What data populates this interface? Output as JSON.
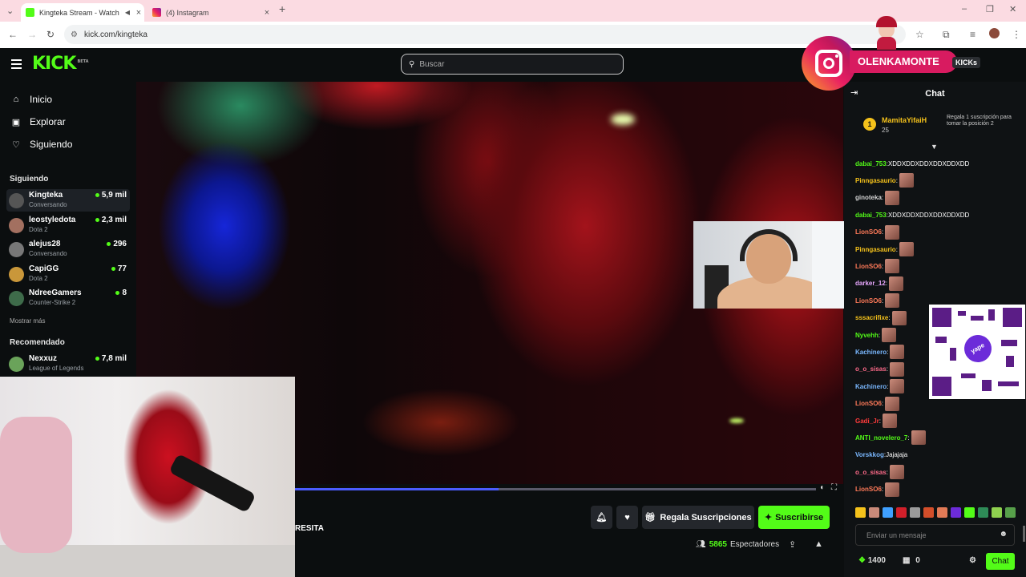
{
  "browser": {
    "tabs": [
      {
        "title": "Kingteka Stream - Watch Li",
        "active": true
      },
      {
        "title": "(4) Instagram",
        "active": false
      }
    ],
    "url": "kick.com/kingteka"
  },
  "header": {
    "logo": "KICK",
    "logo_badge": "BETA",
    "search_placeholder": "Buscar"
  },
  "sidebar": {
    "nav": [
      {
        "label": "Inicio",
        "icon": "home-icon"
      },
      {
        "label": "Explorar",
        "icon": "compass-icon"
      },
      {
        "label": "Siguiendo",
        "icon": "heart-icon"
      }
    ],
    "following_title": "Siguiendo",
    "following": [
      {
        "name": "Kingteka",
        "category": "Conversando",
        "viewers": "5,9 mil"
      },
      {
        "name": "leostyledota",
        "category": "Dota 2",
        "viewers": "2,3 mil"
      },
      {
        "name": "alejus28",
        "category": "Conversando",
        "viewers": "296"
      },
      {
        "name": "CapiGG",
        "category": "Dota 2",
        "viewers": "77"
      },
      {
        "name": "NdreeGamers",
        "category": "Counter-Strike 2",
        "viewers": "8"
      }
    ],
    "show_more": "Mostrar más",
    "recommended_title": "Recomendado",
    "recommended": [
      {
        "name": "Nexxuz",
        "category": "League of Legends",
        "viewers": "7,8 mil"
      }
    ]
  },
  "player": {
    "progress": 0.39
  },
  "stream_info": {
    "streamer_fragment": "RESITA",
    "gift_subs_label": "Regala Suscripciones",
    "subscribe_label": "Suscribirse",
    "viewers_count": "5865",
    "viewers_label": "Espectadores"
  },
  "chat": {
    "title": "Chat",
    "pinned": {
      "rank": "1",
      "user": "MamitaYifaiH",
      "count": "25",
      "text": "Regala 1 suscripción para tomar la posición 2"
    },
    "messages": [
      {
        "user": "dabai_753",
        "text": "XDDXDDXDDXDDXDDXDD",
        "color": "#53fc18",
        "emote": false
      },
      {
        "user": "Pinngasaurio",
        "text": "",
        "color": "#f5c21b",
        "emote": true
      },
      {
        "user": "ginoteka",
        "text": "",
        "color": "#d4d4d4",
        "emote": true
      },
      {
        "user": "dabai_753",
        "text": "XDDXDDXDDXDDXDDXDD",
        "color": "#53fc18",
        "emote": false
      },
      {
        "user": "LionSO6",
        "text": "",
        "color": "#ff7a59",
        "emote": true
      },
      {
        "user": "Pinngasaurio",
        "text": "",
        "color": "#f5c21b",
        "emote": true
      },
      {
        "user": "LionSO6",
        "text": "",
        "color": "#ff7a59",
        "emote": true
      },
      {
        "user": "darker_12",
        "text": "",
        "color": "#e9a8ff",
        "emote": true
      },
      {
        "user": "LionSO6",
        "text": "",
        "color": "#ff7a59",
        "emote": true
      },
      {
        "user": "sssacrifixe",
        "text": "",
        "color": "#f5c21b",
        "emote": true
      },
      {
        "user": "Nyvehh",
        "text": "",
        "color": "#53fc18",
        "emote": true
      },
      {
        "user": "Kachinero",
        "text": "",
        "color": "#7ab8ff",
        "emote": true
      },
      {
        "user": "o_o_sisas",
        "text": "",
        "color": "#ff6b8a",
        "emote": true
      },
      {
        "user": "Kachinero",
        "text": "",
        "color": "#7ab8ff",
        "emote": true
      },
      {
        "user": "LionSO6",
        "text": "",
        "color": "#ff7a59",
        "emote": true
      },
      {
        "user": "Gadi_Jr",
        "text": "",
        "color": "#ff3b3b",
        "emote": true
      },
      {
        "user": "ANTI_novelero_7",
        "text": "",
        "color": "#53fc18",
        "emote": true
      },
      {
        "user": "Vorskkog",
        "text": "Jajajaja",
        "color": "#7ab8ff",
        "emote": false
      },
      {
        "user": "o_o_sisas",
        "text": "",
        "color": "#ff6b8a",
        "emote": true
      },
      {
        "user": "LionSO6",
        "text": "",
        "color": "#ff7a59",
        "emote": true
      }
    ],
    "input_placeholder": "Enviar un mensaje",
    "points": "1400",
    "gifts": "0",
    "send_label": "Chat"
  },
  "overlay": {
    "instagram_handle": "OLENKAMONTE",
    "kicks_label": "KICKs",
    "qr_label": "yape"
  },
  "colors": {
    "brand": "#53fc18",
    "background": "#0b0e0f",
    "instagram": "#d81b60"
  }
}
